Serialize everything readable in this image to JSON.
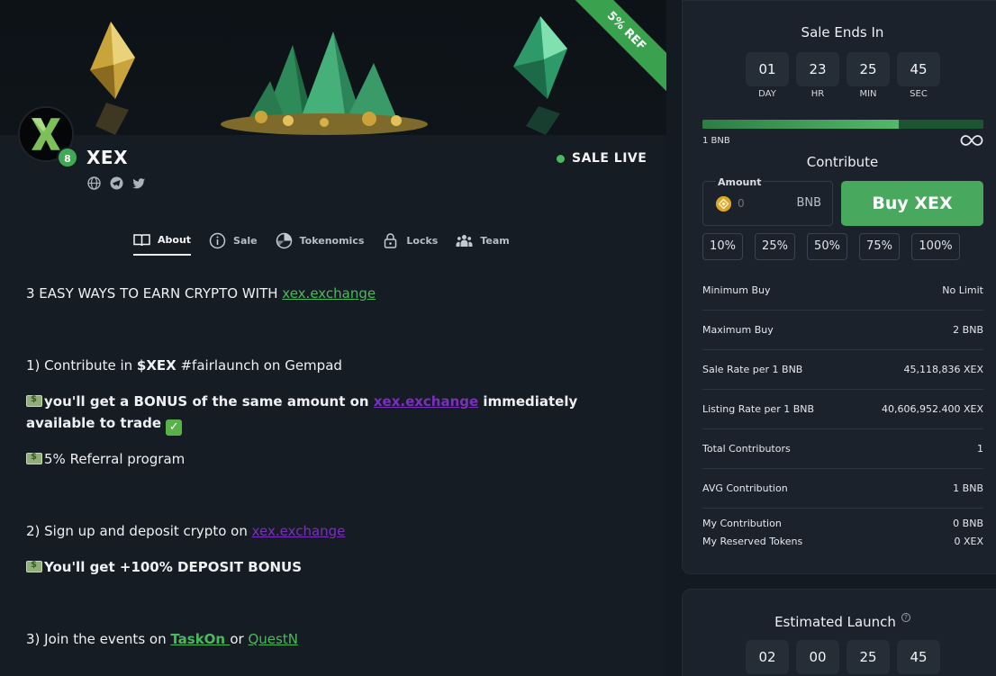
{
  "ribbon": "5% REF",
  "project": {
    "name": "XEX",
    "kyc_badge": "8",
    "status": "SALE LIVE",
    "status_color": "#4bb85f"
  },
  "tabs": [
    {
      "label": "About",
      "icon": "book-icon",
      "active": true
    },
    {
      "label": "Sale",
      "icon": "info-icon",
      "active": false
    },
    {
      "label": "Tokenomics",
      "icon": "pie-chart-icon",
      "active": false
    },
    {
      "label": "Locks",
      "icon": "lock-icon",
      "active": false
    },
    {
      "label": "Team",
      "icon": "team-icon",
      "active": false
    }
  ],
  "about": {
    "line1_text": "3 EASY WAYS TO EARN CRYPTO WITH ",
    "line1_link": "xex.exchange ",
    "line2_a": "1) Contribute in ",
    "line2_b": "$XEX",
    "line2_c": " #fairlaunch on Gempad",
    "line3_a": "you'll get a BONUS of the same amount on ",
    "line3_link": "xex.exchange",
    "line3_b": " immediately",
    "line4": "available to trade ",
    "line5": "5% Referral program",
    "line6_a": "2) Sign up and deposit crypto on ",
    "line6_link": "xex.exchange",
    "line7": "You'll get +100% DEPOSIT BONUS",
    "line8_a": "3) Join the events on ",
    "line8_link1": "TaskOn ",
    "line8_b": "or ",
    "line8_link2": "QuestN"
  },
  "sale": {
    "ends_title": "Sale Ends In",
    "countdown": [
      {
        "value": "01",
        "label": "DAY"
      },
      {
        "value": "23",
        "label": "HR"
      },
      {
        "value": "25",
        "label": "MIN"
      },
      {
        "value": "45",
        "label": "SEC"
      }
    ],
    "progress_fraction": 0.7,
    "progress_min_label": "1 BNB",
    "progress_max_icon": "infinity-icon",
    "contribute_title": "Contribute",
    "amount_label": "Amount",
    "amount_placeholder": "0",
    "amount_unit": "BNB",
    "buy_label": "Buy XEX",
    "percentages": [
      "10%",
      "25%",
      "50%",
      "75%",
      "100%"
    ],
    "info": [
      {
        "label": "Minimum Buy",
        "value": "No Limit"
      },
      {
        "label": "Maximum Buy",
        "value": "2 BNB"
      },
      {
        "label": "Sale Rate per 1 BNB",
        "value": "45,118,836 XEX"
      },
      {
        "label": "Listing Rate per 1 BNB",
        "value": "40,606,952.400 XEX"
      },
      {
        "label": "Total Contributors",
        "value": "1"
      },
      {
        "label": "AVG Contribution",
        "value": "1 BNB"
      }
    ],
    "my_contribution_label": "My Contribution",
    "my_contribution_value": "0 BNB",
    "my_reserved_label": "My Reserved Tokens",
    "my_reserved_value": "0 XEX"
  },
  "launch": {
    "title": "Estimated Launch",
    "countdown": [
      "02",
      "00",
      "25",
      "45"
    ]
  }
}
